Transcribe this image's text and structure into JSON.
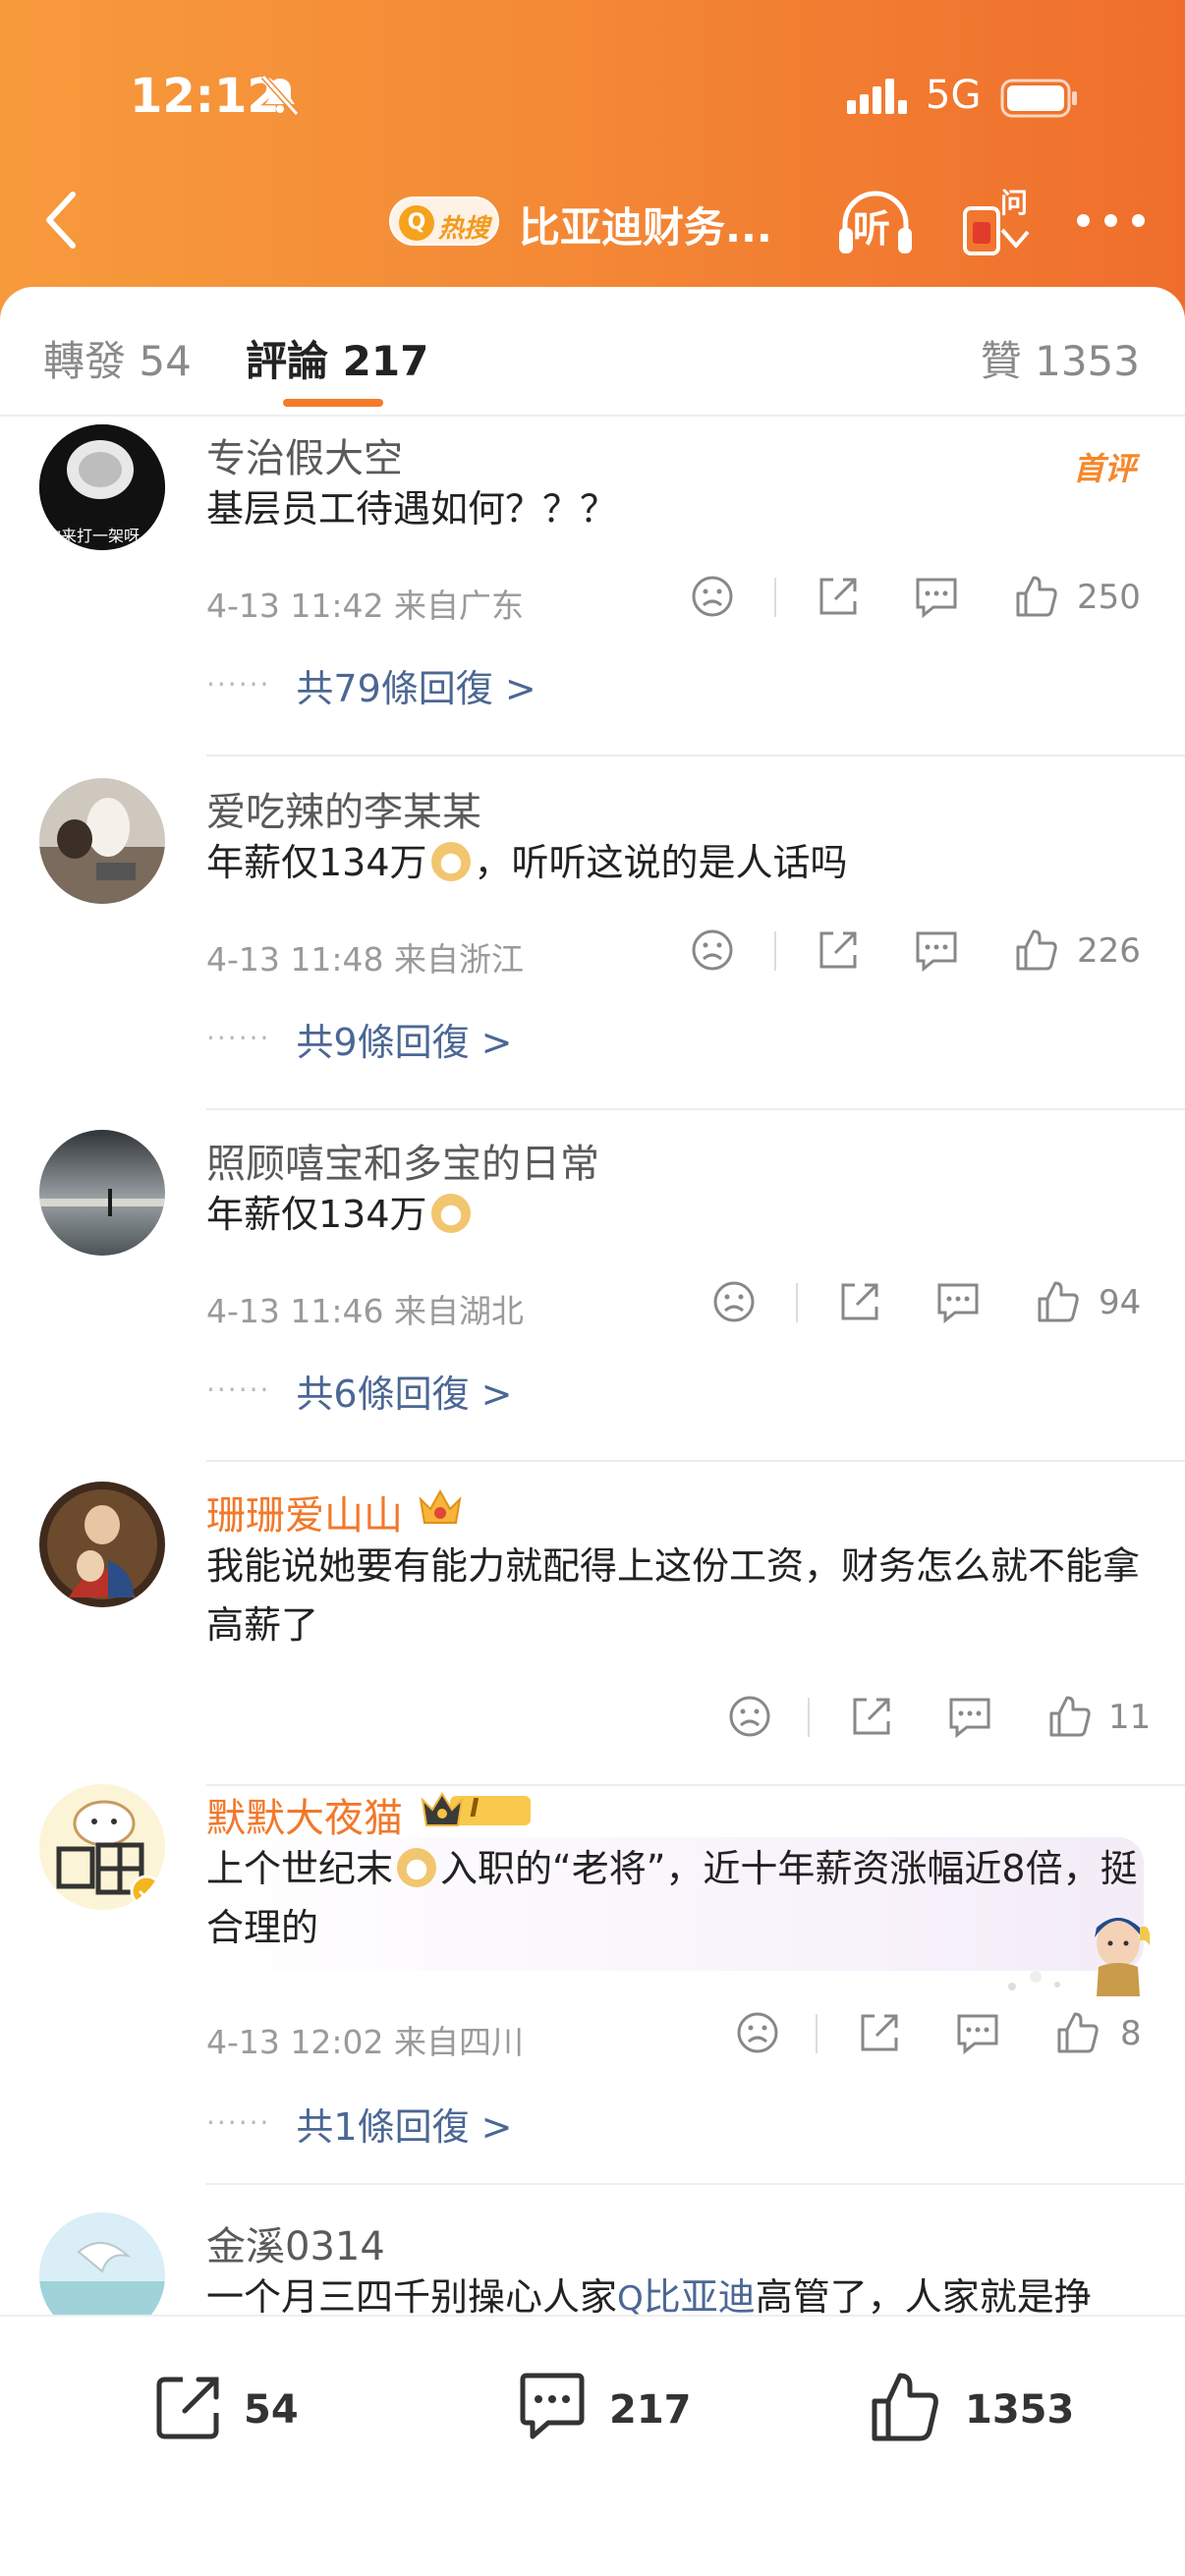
{
  "status_bar": {
    "time": "12:12",
    "network": "5G"
  },
  "nav": {
    "hot_badge": "热搜",
    "title": "比亚迪财务...",
    "listen": "听"
  },
  "tabs": {
    "forward": "轉發 54",
    "comments": "評論 217",
    "likes": "贊 1353"
  },
  "comments": [
    {
      "username": "专治假大空",
      "badge": "首评",
      "text": "基层员工待遇如何？？？",
      "meta": "4-13 11:42  来自广东",
      "likes": "250",
      "replies": "共79條回復 >",
      "avatar_caption": "你来打一架呀"
    },
    {
      "username": "爱吃辣的李某某",
      "text_before": "年薪仅134万",
      "text_after": "，听听这说的是人话吗",
      "meta": "4-13 11:48  来自浙江",
      "likes": "226",
      "replies": "共9條回復 >"
    },
    {
      "username": "照顾嘻宝和多宝的日常",
      "text_before": "年薪仅134万",
      "meta": "4-13 11:46  来自湖北",
      "likes": "94",
      "replies": "共6條回復 >"
    },
    {
      "username": "珊珊爱山山",
      "text": "我能说她要有能力就配得上这份工资，财务怎么就不能拿高薪了",
      "likes": "11"
    },
    {
      "username": "默默大夜猫",
      "text_before": "上个世纪末",
      "text_after": "入职的“老将”，近十年薪资涨幅近8倍，挺合理的",
      "meta": "4-13 12:02  来自四川",
      "likes": "8",
      "replies": "共1條回復 >",
      "level": "I"
    },
    {
      "username": "金溪0314",
      "text_before": "一个月三四千别操心人家",
      "topic": "比亚迪",
      "text_after": "高管了，人家就是挣"
    }
  ],
  "bottom_bar": {
    "forward": "54",
    "comments": "217",
    "likes": "1353"
  },
  "colors": {
    "header_start": "#f79a3c",
    "header_end": "#ef6e2c",
    "accent": "#f57a2a",
    "link": "#4b6794"
  }
}
